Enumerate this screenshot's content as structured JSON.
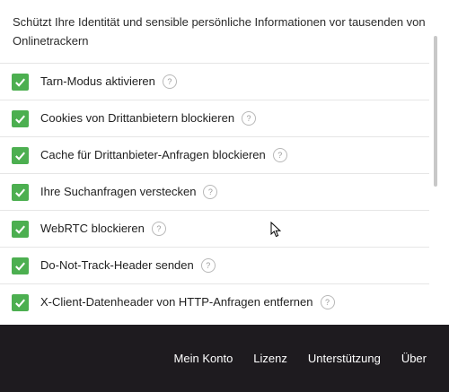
{
  "intro_text": "Schützt Ihre Identität und sensible persönliche Informationen vor tausenden von Onlinetrackern",
  "colors": {
    "checkbox": "#4caf50",
    "footer_bg": "#1e1b1f"
  },
  "options": [
    {
      "label": "Tarn-Modus aktivieren",
      "checked": true,
      "help_icon": "?"
    },
    {
      "label": "Cookies von Drittanbietern blockieren",
      "checked": true,
      "help_icon": "?"
    },
    {
      "label": "Cache für Drittanbieter-Anfragen blockieren",
      "checked": true,
      "help_icon": "?"
    },
    {
      "label": "Ihre Suchanfragen verstecken",
      "checked": true,
      "help_icon": "?"
    },
    {
      "label": "WebRTC blockieren",
      "checked": true,
      "help_icon": "?"
    },
    {
      "label": "Do-Not-Track-Header senden",
      "checked": true,
      "help_icon": "?"
    },
    {
      "label": "X-Client-Datenheader von HTTP-Anfragen entfernen",
      "checked": true,
      "help_icon": "?"
    }
  ],
  "footer": {
    "links": [
      "Mein Konto",
      "Lizenz",
      "Unterstützung",
      "Über"
    ]
  }
}
